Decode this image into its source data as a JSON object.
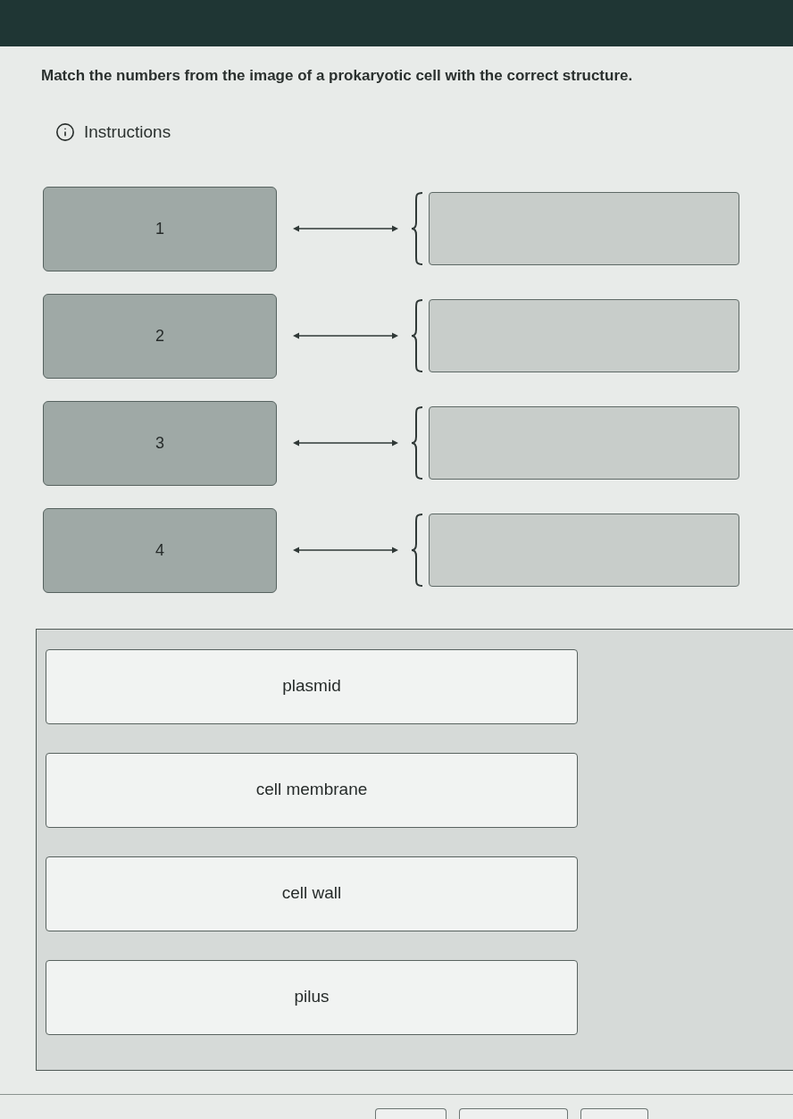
{
  "question": "Match the numbers from the image of a prokaryotic cell with the correct structure.",
  "instructions": {
    "label": "Instructions"
  },
  "rows": [
    {
      "number": "1"
    },
    {
      "number": "2"
    },
    {
      "number": "3"
    },
    {
      "number": "4"
    }
  ],
  "answer_bank": [
    {
      "label": "plasmid"
    },
    {
      "label": "cell membrane"
    },
    {
      "label": "cell wall"
    },
    {
      "label": "pilus"
    }
  ]
}
